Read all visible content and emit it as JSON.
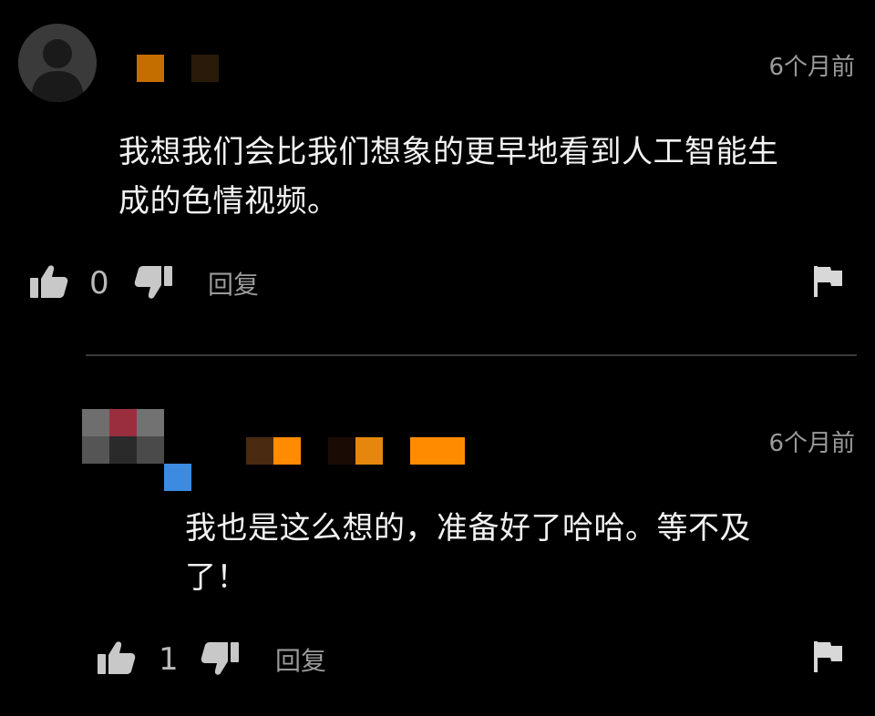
{
  "comments": [
    {
      "timestamp": "6个月前",
      "text": "我想我们会比我们想象的更早地看到人工智能生\n成的色情视频。",
      "like_count": "0",
      "reply_label": "回复",
      "name_block_colors": [
        "#c56e00",
        "#2a1a0a"
      ]
    },
    {
      "timestamp": "6个月前",
      "text": "我也是这么想的，准备好了哈哈。等不及\n了！",
      "like_count": "1",
      "reply_label": "回复",
      "name_block_colors": [
        "#4a2a10",
        "#ff8c00",
        "#1a0c05",
        "#e5870c",
        "#ff8c00"
      ],
      "avatar_pixel_colors": [
        "#6e6e6e",
        "#9a2e3e",
        "#727272",
        "#555555",
        "#2a2a2a",
        "#4a4a4a",
        "#3d8be0"
      ]
    }
  ],
  "icons": {
    "avatar": "user-silhouette-icon",
    "like": "thumbs-up-icon",
    "dislike": "thumbs-down-icon",
    "report": "flag-icon"
  }
}
